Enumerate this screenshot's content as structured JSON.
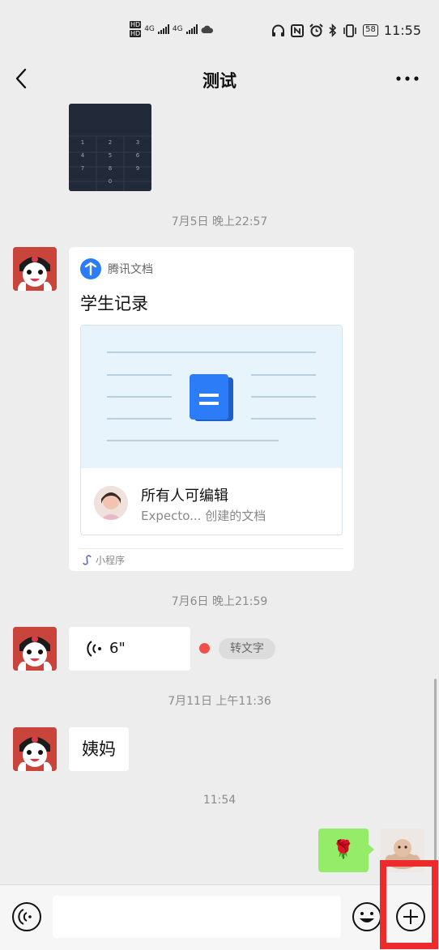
{
  "status_bar": {
    "network_left": "4G",
    "network_right": "4G",
    "battery": "58",
    "time": "11:55"
  },
  "header": {
    "title": "测试"
  },
  "messages": {
    "image_keypad": [
      "1",
      "2",
      "3",
      "4",
      "5",
      "6",
      "7",
      "8",
      "9",
      "",
      "0",
      ""
    ],
    "ts1": "7月5日 晚上22:57",
    "doc_card": {
      "source": "腾讯文档",
      "title": "学生记录",
      "permission": "所有人可编辑",
      "creator": "Expecto... 创建的文档",
      "mini_program": "小程序"
    },
    "ts2": "7月6日 晚上21:59",
    "voice": {
      "duration": "6\"",
      "to_text": "转文字"
    },
    "ts3": "7月11日 上午11:36",
    "text_msg": "姨妈",
    "ts4": "11:54",
    "sent_emoji": "🌹"
  },
  "input_bar": {
    "placeholder": ""
  },
  "colors": {
    "chat_bg": "#ededed",
    "sent_bubble": "#95ec69",
    "highlight": "#ee2b2b",
    "unread": "#f0504a",
    "doc_blue": "#2b7cf6"
  }
}
